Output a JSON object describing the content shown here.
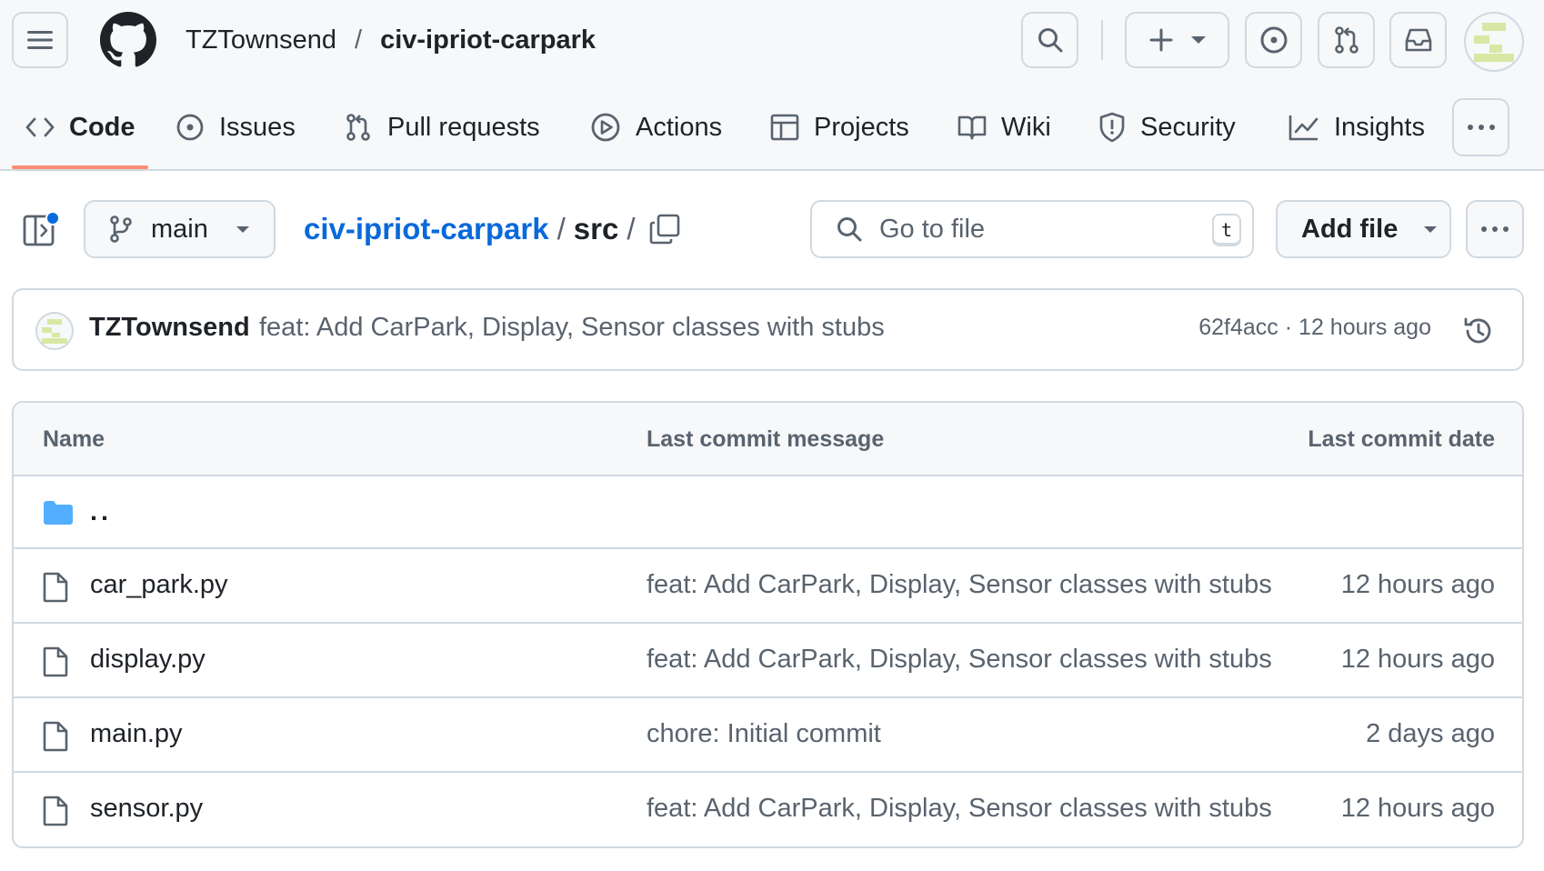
{
  "header": {
    "owner": "TZTownsend",
    "separator": "/",
    "repo": "civ-ipriot-carpark"
  },
  "tabs": [
    {
      "label": "Code",
      "icon": "code-icon",
      "active": true
    },
    {
      "label": "Issues",
      "icon": "issue-opened-icon"
    },
    {
      "label": "Pull requests",
      "icon": "git-pull-request-icon"
    },
    {
      "label": "Actions",
      "icon": "play-icon"
    },
    {
      "label": "Projects",
      "icon": "table-icon"
    },
    {
      "label": "Wiki",
      "icon": "book-icon"
    },
    {
      "label": "Security",
      "icon": "shield-icon"
    },
    {
      "label": "Insights",
      "icon": "graph-icon"
    }
  ],
  "toolbar": {
    "branch": "main",
    "crumb_root": "civ-ipriot-carpark",
    "crumb_sep": "/",
    "crumb_dir": "src",
    "crumb_trail": "/",
    "goto_placeholder": "Go to file",
    "goto_shortcut": "t",
    "add_file": "Add file"
  },
  "latest_commit": {
    "author": "TZTownsend",
    "message": "feat: Add CarPark, Display, Sensor classes with stubs",
    "sha": "62f4acc",
    "meta_sep": "·",
    "time": "12 hours ago"
  },
  "table": {
    "headers": {
      "name": "Name",
      "message": "Last commit message",
      "date": "Last commit date"
    },
    "parent_label": "..",
    "rows": [
      {
        "name": "car_park.py",
        "message": "feat: Add CarPark, Display, Sensor classes with stubs",
        "date": "12 hours ago"
      },
      {
        "name": "display.py",
        "message": "feat: Add CarPark, Display, Sensor classes with stubs",
        "date": "12 hours ago"
      },
      {
        "name": "main.py",
        "message": "chore: Initial commit",
        "date": "2 days ago"
      },
      {
        "name": "sensor.py",
        "message": "feat: Add CarPark, Display, Sensor classes with stubs",
        "date": "12 hours ago"
      }
    ]
  },
  "colors": {
    "accent_link": "#0969da",
    "tab_underline": "#fd8c73",
    "folder": "#54aeff",
    "avatar_identicon": "#d8e8a4"
  }
}
